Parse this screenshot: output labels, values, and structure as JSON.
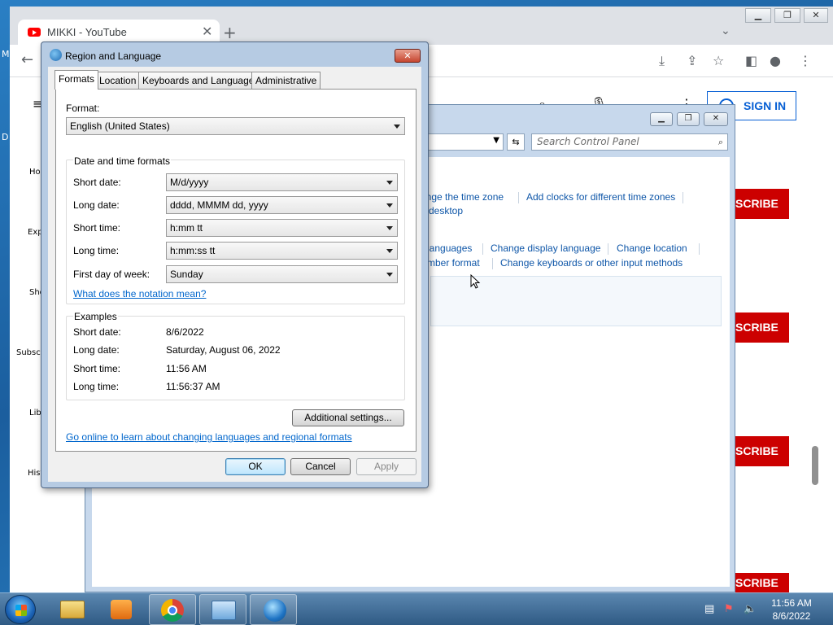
{
  "desktop": {
    "edge_letters": [
      "M",
      "D"
    ]
  },
  "chrome": {
    "tab_title": "MIKKI - YouTube",
    "tab_close": "✕",
    "new_tab": "+",
    "signin": "SIGN IN",
    "subscribe": "SCRIBE",
    "sidebar_items": [
      "Ho",
      "Exp",
      "Sho",
      "Subscri",
      "Libr",
      "Hist"
    ]
  },
  "control_panel": {
    "search_placeholder": "Search Control Panel",
    "links": {
      "change_time_zone": "ange the time zone",
      "add_clocks": "Add clocks for different time zones",
      "desktop": "desktop",
      "languages": "languages",
      "change_display_language": "Change display language",
      "change_location": "Change location",
      "number_format": "mber format",
      "change_keyboards": "Change keyboards or other input methods"
    }
  },
  "dialog": {
    "title": "Region and Language",
    "tabs": [
      "Formats",
      "Location",
      "Keyboards and Languages",
      "Administrative"
    ],
    "format_label": "Format:",
    "format_value": "English (United States)",
    "datetime_group_title": "Date and time formats",
    "fields": [
      {
        "label": "Short date:",
        "value": "M/d/yyyy"
      },
      {
        "label": "Long date:",
        "value": "dddd, MMMM dd, yyyy"
      },
      {
        "label": "Short time:",
        "value": "h:mm tt"
      },
      {
        "label": "Long time:",
        "value": "h:mm:ss tt"
      },
      {
        "label": "First day of week:",
        "value": "Sunday"
      }
    ],
    "notation_link": "What does the notation mean?",
    "examples_title": "Examples",
    "examples": [
      {
        "label": "Short date:",
        "value": "8/6/2022"
      },
      {
        "label": "Long date:",
        "value": "Saturday, August 06, 2022"
      },
      {
        "label": "Short time:",
        "value": "11:56 AM"
      },
      {
        "label": "Long time:",
        "value": "11:56:37 AM"
      }
    ],
    "additional_settings": "Additional settings...",
    "online_link": "Go online to learn about changing languages and regional formats",
    "ok": "OK",
    "cancel": "Cancel",
    "apply": "Apply"
  },
  "taskbar": {
    "time": "11:56 AM",
    "date": "8/6/2022"
  }
}
